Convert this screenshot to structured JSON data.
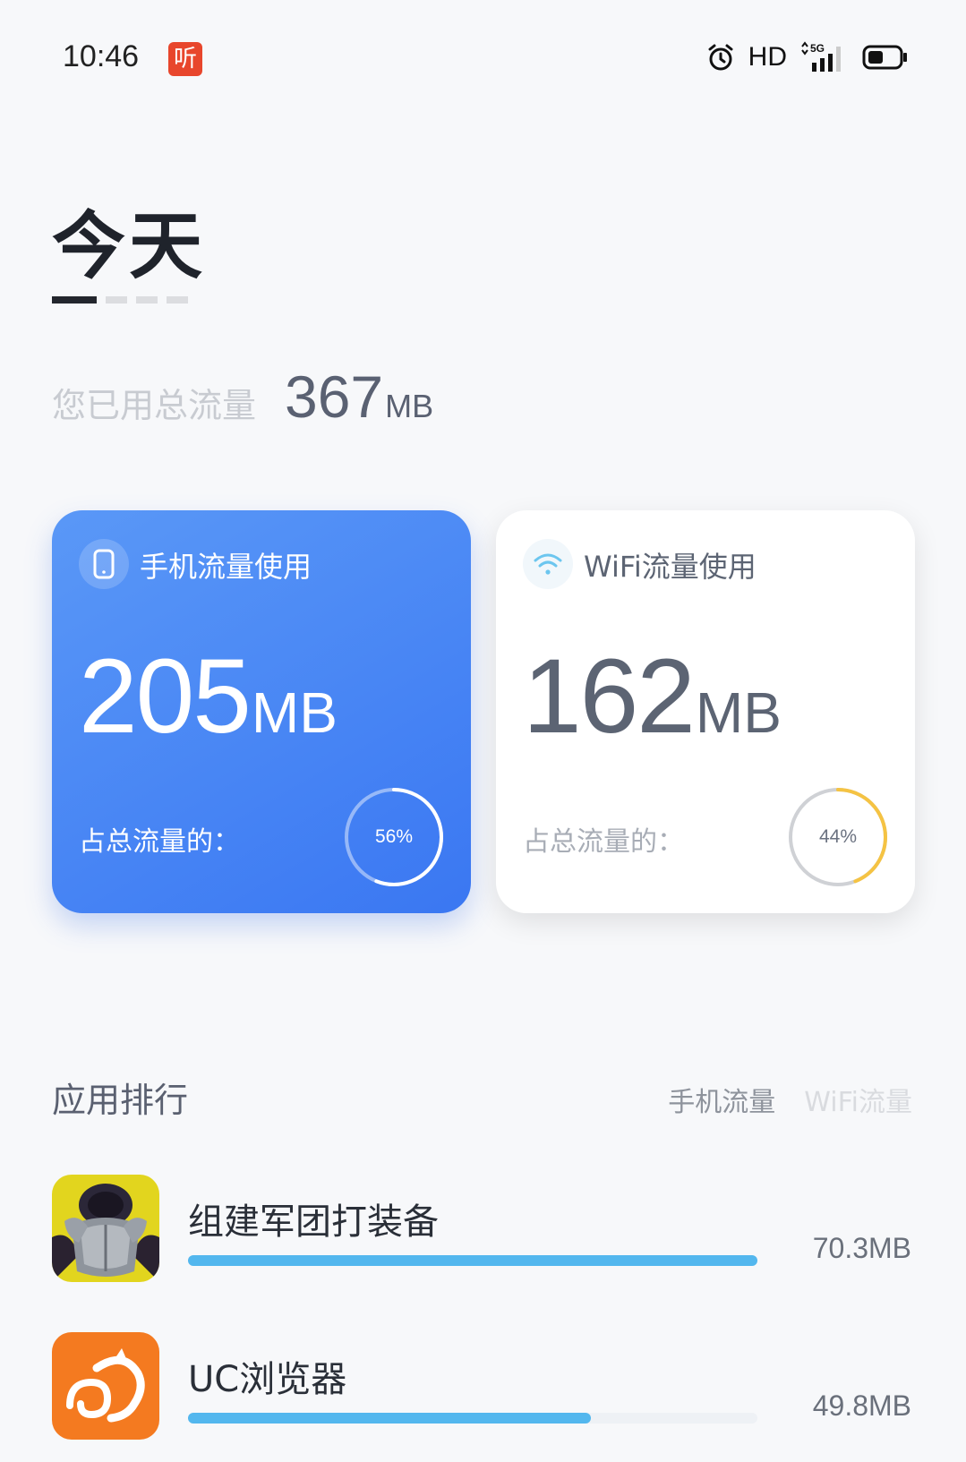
{
  "status_bar": {
    "time": "10:46",
    "listen_badge": "听",
    "hd": "HD",
    "network": "5G",
    "icons": [
      "alarm-icon",
      "signal-icon",
      "battery-icon"
    ]
  },
  "page": {
    "title": "今天",
    "pager_count": 4,
    "pager_active": 0
  },
  "total": {
    "label": "您已用总流量",
    "value": "367",
    "unit": "MB"
  },
  "cards": {
    "mobile": {
      "title": "手机流量使用",
      "value": "205",
      "unit": "MB",
      "share_label": "占总流量的：",
      "percent_label": "56%",
      "percent": 56,
      "icon": "phone-icon",
      "color": "#3f7ef3"
    },
    "wifi": {
      "title": "WiFi流量使用",
      "value": "162",
      "unit": "MB",
      "share_label": "占总流量的：",
      "percent_label": "44%",
      "percent": 44,
      "icon": "wifi-icon",
      "color": "#f5c343"
    }
  },
  "ranking": {
    "title": "应用排行",
    "tabs": [
      {
        "label": "手机流量",
        "active": true
      },
      {
        "label": "WiFi流量",
        "active": false
      }
    ],
    "apps": [
      {
        "name": "组建军团打装备",
        "size": "70.3MB",
        "fraction": 1.0,
        "icon": "armor-game-icon"
      },
      {
        "name": "UC浏览器",
        "size": "49.8MB",
        "fraction": 0.708,
        "icon": "uc-browser-icon"
      }
    ]
  }
}
